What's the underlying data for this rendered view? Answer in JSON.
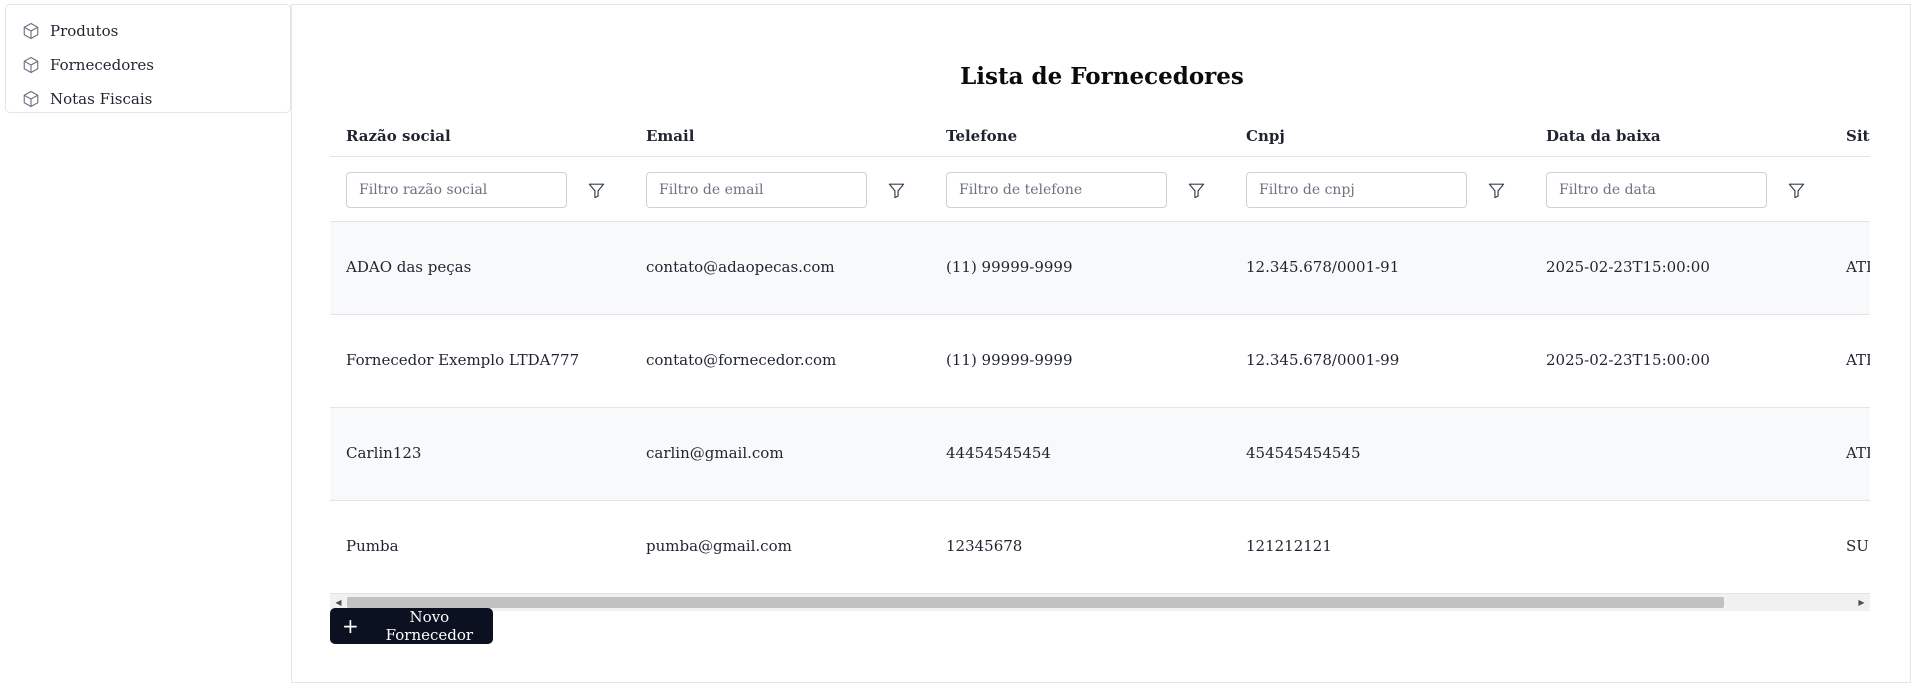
{
  "sidebar": {
    "items": [
      {
        "label": "Produtos",
        "icon": "box-icon"
      },
      {
        "label": "Fornecedores",
        "icon": "box-icon"
      },
      {
        "label": "Notas Fiscais",
        "icon": "box-icon"
      }
    ]
  },
  "main": {
    "title": "Lista de Fornecedores",
    "columns": [
      "Razão social",
      "Email",
      "Telefone",
      "Cnpj",
      "Data da baixa",
      "Situ"
    ],
    "filters": [
      {
        "placeholder": "Filtro razão social"
      },
      {
        "placeholder": "Filtro de email"
      },
      {
        "placeholder": "Filtro de telefone"
      },
      {
        "placeholder": "Filtro de cnpj"
      },
      {
        "placeholder": "Filtro de data"
      }
    ],
    "rows": [
      {
        "razao": "ADAO das peças",
        "email": "contato@adaopecas.com",
        "telefone": "(11) 99999-9999",
        "cnpj": "12.345.678/0001-91",
        "data": "2025-02-23T15:00:00",
        "situacao": "ATI"
      },
      {
        "razao": "Fornecedor Exemplo LTDA777",
        "email": "contato@fornecedor.com",
        "telefone": "(11) 99999-9999",
        "cnpj": "12.345.678/0001-99",
        "data": "2025-02-23T15:00:00",
        "situacao": "ATI"
      },
      {
        "razao": "Carlin123",
        "email": "carlin@gmail.com",
        "telefone": "44454545454",
        "cnpj": "454545454545",
        "data": "",
        "situacao": "ATI"
      },
      {
        "razao": "Pumba",
        "email": "pumba@gmail.com",
        "telefone": "12345678",
        "cnpj": "121212121",
        "data": "",
        "situacao": "SUS"
      }
    ],
    "new_button": "Novo Fornecedor"
  },
  "colors": {
    "button_bg": "#0b1120",
    "row_alt": "#f8f9fa",
    "border": "#e3e5e8"
  }
}
